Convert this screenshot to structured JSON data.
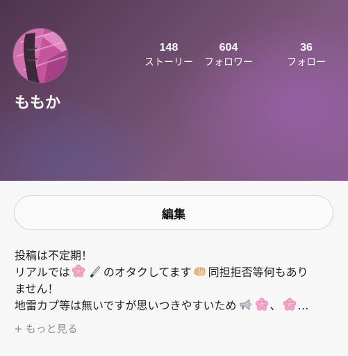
{
  "profile": {
    "username": "ももか",
    "avatar_icon": "profile-photo"
  },
  "stats": {
    "stories": {
      "count": "148",
      "label": "ストーリー"
    },
    "followers": {
      "count": "604",
      "label": "フォロワー"
    },
    "following": {
      "count": "36",
      "label": "フォロー"
    }
  },
  "actions": {
    "edit_label": "編集"
  },
  "bio": {
    "line1": "投稿は不定期！",
    "line2_a": "リアルでは",
    "line2_b": "のオタクしてます",
    "line2_c": "同担拒否等何もあり",
    "line3": "ません！",
    "line4_a": "地雷カプ等は無いですが思いつきやすいため",
    "line4_sep": "、",
    "line4_ellipsis": "…",
    "emojis": [
      "cherry-blossom",
      "knife",
      "fist",
      "megaphone",
      "cherry-blossom",
      "cherry-blossom"
    ]
  },
  "more": {
    "label": "もっと見る",
    "prefix": "+"
  },
  "colors": {
    "header_start": "#4f3350",
    "header_end": "#8a5d92",
    "background": "#f7f7f7",
    "text": "#222222",
    "muted": "#8e8e8e"
  }
}
